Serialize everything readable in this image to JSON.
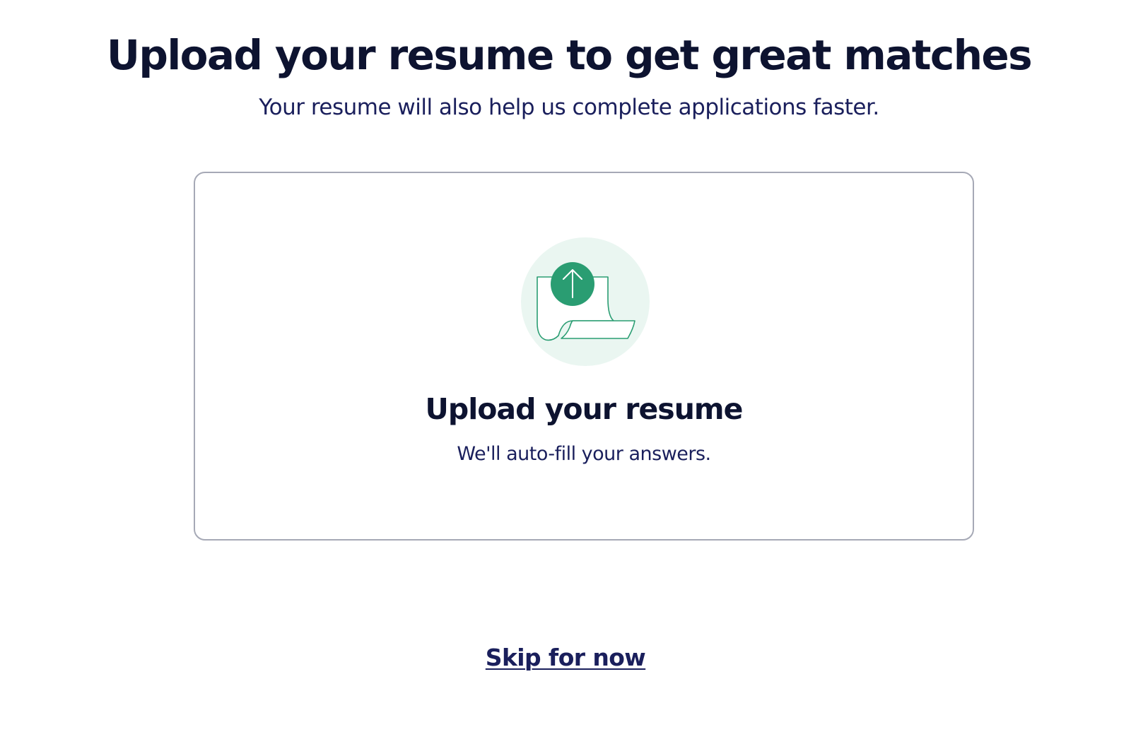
{
  "header": {
    "title": "Upload your resume to get great matches",
    "subtitle": "Your resume will also help us complete applications faster."
  },
  "upload_card": {
    "icon": "resume-upload-icon",
    "title": "Upload your resume",
    "subtitle": "We'll auto-fill your answers."
  },
  "footer": {
    "skip_label": "Skip for now"
  },
  "colors": {
    "text_primary": "#0d1330",
    "text_secondary": "#1a1f5c",
    "accent_green": "#2a9d72",
    "icon_bg": "#eaf6f1",
    "card_border": "#a6a9b6"
  }
}
